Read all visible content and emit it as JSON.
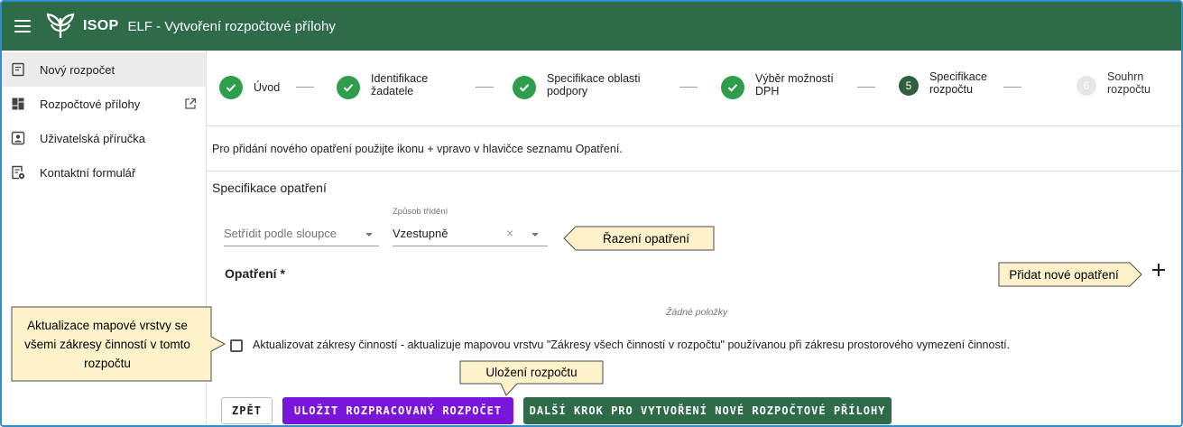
{
  "header": {
    "brand": "ISOP",
    "title": "ELF - Vytvoření rozpočtové přílohy"
  },
  "sidebar": {
    "items": [
      {
        "label": "Nový rozpočet",
        "icon": "new-budget-icon"
      },
      {
        "label": "Rozpočtové přílohy",
        "icon": "dashboard-icon"
      },
      {
        "label": "Uživatelská příručka",
        "icon": "user-guide-icon"
      },
      {
        "label": "Kontaktní formulář",
        "icon": "contact-form-icon"
      }
    ]
  },
  "stepper": {
    "steps": [
      {
        "label": "Úvod",
        "state": "done"
      },
      {
        "label": "Identifikace\nžadatele",
        "state": "done"
      },
      {
        "label": "Specifikace oblasti\npodpory",
        "state": "done"
      },
      {
        "label": "Výběr možností\nDPH",
        "state": "done"
      },
      {
        "number": "5",
        "label": "Specifikace\nrozpočtu",
        "state": "current"
      },
      {
        "number": "6",
        "label": "Souhrn\nrozpočtu",
        "state": "future"
      }
    ]
  },
  "info_text": "Pro přidání nového opatření použijte ikonu + vpravo v hlavičce seznamu Opatření.",
  "section": {
    "title": "Specifikace opatření",
    "sort_column_placeholder": "Setřídit podle sloupce",
    "sort_order_label": "Způsob třídění",
    "sort_order_value": "Vzestupně",
    "list_title": "Opatření *",
    "empty_text": "Žádné položky",
    "checkbox_label": "Aktualizovat zákresy činností - aktualizuje mapovou vrstvu \"Zákresy všech činností v rozpočtu\" používanou při zákresu prostorového vymezení činností."
  },
  "callouts": {
    "sorting": "Řazení opatření",
    "add": "Přidat nové opatření",
    "map_update": "Aktualizace mapové vrstvy se všemi zákresy činností v tomto rozpočtu",
    "save": "Uložení rozpočtu"
  },
  "buttons": {
    "back": "ZPĚT",
    "save": "ULOŽIT ROZPRACOVANÝ ROZPOČET",
    "next": "DALŠÍ KROK PRO VYTVOŘENÍ NOVÉ ROZPOČTOVÉ PŘÍLOHY"
  },
  "colors": {
    "header": "#2e6b48",
    "step_done": "#2e9e4c",
    "step_current": "#2e5f3f",
    "save_button": "#7a16dc",
    "next_button": "#2e6b48",
    "callout_fill": "#fdf2c9"
  }
}
